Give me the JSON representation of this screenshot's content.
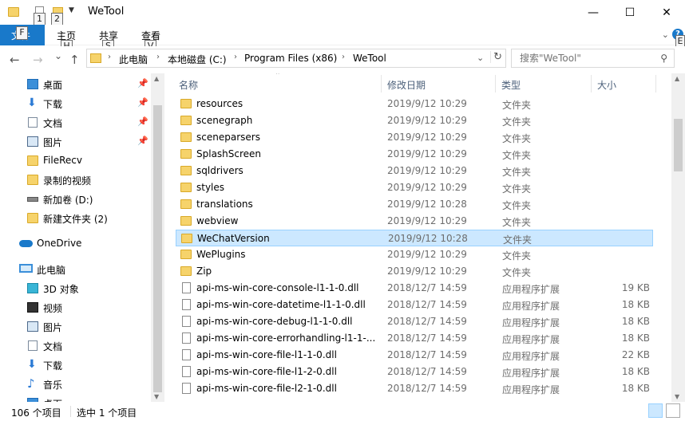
{
  "window": {
    "title": "WeTool",
    "keytips": [
      "1",
      "2"
    ],
    "controls": {
      "minimize": "—",
      "maximize": "☐",
      "close": "✕"
    }
  },
  "ribbon": {
    "file_tab": "文件",
    "file_keytip": "F",
    "tabs": [
      {
        "label": "主页",
        "keytip": "H"
      },
      {
        "label": "共享",
        "keytip": "S"
      },
      {
        "label": "查看",
        "keytip": "V"
      }
    ],
    "expand_icon": "chevron-down-icon",
    "help_label": "?",
    "help_keytip": "E"
  },
  "nav": {
    "back": "←",
    "forward": "→",
    "recent": "⌄",
    "up": "↑",
    "breadcrumbs": [
      "此电脑",
      "本地磁盘 (C:)",
      "Program Files (x86)",
      "WeTool"
    ],
    "separator": "›",
    "refresh": "↻",
    "search_placeholder": "搜索\"WeTool\"",
    "search_icon": "⚲"
  },
  "sidebar": {
    "quick_access": [
      {
        "label": "桌面",
        "icon": "desktop-icon",
        "pinned": true
      },
      {
        "label": "下载",
        "icon": "download-icon",
        "pinned": true
      },
      {
        "label": "文档",
        "icon": "document-icon",
        "pinned": true
      },
      {
        "label": "图片",
        "icon": "pictures-icon",
        "pinned": true
      },
      {
        "label": "FileRecv",
        "icon": "folder-icon",
        "pinned": false
      },
      {
        "label": "录制的视频",
        "icon": "folder-icon",
        "pinned": false
      },
      {
        "label": "新加卷 (D:)",
        "icon": "drive-icon",
        "pinned": false
      },
      {
        "label": "新建文件夹 (2)",
        "icon": "folder-icon",
        "pinned": false
      }
    ],
    "onedrive": "OneDrive",
    "this_pc": "此电脑",
    "this_pc_items": [
      {
        "label": "3D 对象",
        "icon": "3d-objects-icon"
      },
      {
        "label": "视频",
        "icon": "videos-icon"
      },
      {
        "label": "图片",
        "icon": "pictures-icon"
      },
      {
        "label": "文档",
        "icon": "document-icon"
      },
      {
        "label": "下载",
        "icon": "download-icon"
      },
      {
        "label": "音乐",
        "icon": "music-icon"
      },
      {
        "label": "桌面",
        "icon": "desktop-icon"
      }
    ],
    "pin_glyph": "📌"
  },
  "columns": {
    "name": "名称",
    "date": "修改日期",
    "type": "类型",
    "size": "大小"
  },
  "files": [
    {
      "name": "resources",
      "date": "2019/9/12 10:29",
      "type": "文件夹",
      "size": "",
      "kind": "folder"
    },
    {
      "name": "scenegraph",
      "date": "2019/9/12 10:29",
      "type": "文件夹",
      "size": "",
      "kind": "folder"
    },
    {
      "name": "sceneparsers",
      "date": "2019/9/12 10:29",
      "type": "文件夹",
      "size": "",
      "kind": "folder"
    },
    {
      "name": "SplashScreen",
      "date": "2019/9/12 10:29",
      "type": "文件夹",
      "size": "",
      "kind": "folder"
    },
    {
      "name": "sqldrivers",
      "date": "2019/9/12 10:29",
      "type": "文件夹",
      "size": "",
      "kind": "folder"
    },
    {
      "name": "styles",
      "date": "2019/9/12 10:29",
      "type": "文件夹",
      "size": "",
      "kind": "folder"
    },
    {
      "name": "translations",
      "date": "2019/9/12 10:28",
      "type": "文件夹",
      "size": "",
      "kind": "folder"
    },
    {
      "name": "webview",
      "date": "2019/9/12 10:29",
      "type": "文件夹",
      "size": "",
      "kind": "folder"
    },
    {
      "name": "WeChatVersion",
      "date": "2019/9/12 10:28",
      "type": "文件夹",
      "size": "",
      "kind": "folder",
      "selected": true
    },
    {
      "name": "WePlugins",
      "date": "2019/9/12 10:29",
      "type": "文件夹",
      "size": "",
      "kind": "folder"
    },
    {
      "name": "Zip",
      "date": "2019/9/12 10:29",
      "type": "文件夹",
      "size": "",
      "kind": "folder"
    },
    {
      "name": "api-ms-win-core-console-l1-1-0.dll",
      "date": "2018/12/7 14:59",
      "type": "应用程序扩展",
      "size": "19 KB",
      "kind": "dll"
    },
    {
      "name": "api-ms-win-core-datetime-l1-1-0.dll",
      "date": "2018/12/7 14:59",
      "type": "应用程序扩展",
      "size": "18 KB",
      "kind": "dll"
    },
    {
      "name": "api-ms-win-core-debug-l1-1-0.dll",
      "date": "2018/12/7 14:59",
      "type": "应用程序扩展",
      "size": "18 KB",
      "kind": "dll"
    },
    {
      "name": "api-ms-win-core-errorhandling-l1-1-...",
      "date": "2018/12/7 14:59",
      "type": "应用程序扩展",
      "size": "18 KB",
      "kind": "dll"
    },
    {
      "name": "api-ms-win-core-file-l1-1-0.dll",
      "date": "2018/12/7 14:59",
      "type": "应用程序扩展",
      "size": "22 KB",
      "kind": "dll"
    },
    {
      "name": "api-ms-win-core-file-l1-2-0.dll",
      "date": "2018/12/7 14:59",
      "type": "应用程序扩展",
      "size": "18 KB",
      "kind": "dll"
    },
    {
      "name": "api-ms-win-core-file-l2-1-0.dll",
      "date": "2018/12/7 14:59",
      "type": "应用程序扩展",
      "size": "18 KB",
      "kind": "dll"
    }
  ],
  "status": {
    "item_count": "106 个项目",
    "selection": "选中 1 个项目"
  },
  "colors": {
    "accent": "#1979ca",
    "selection": "#cce8ff",
    "selection_border": "#99d1ff",
    "header_text": "#4c607a"
  }
}
